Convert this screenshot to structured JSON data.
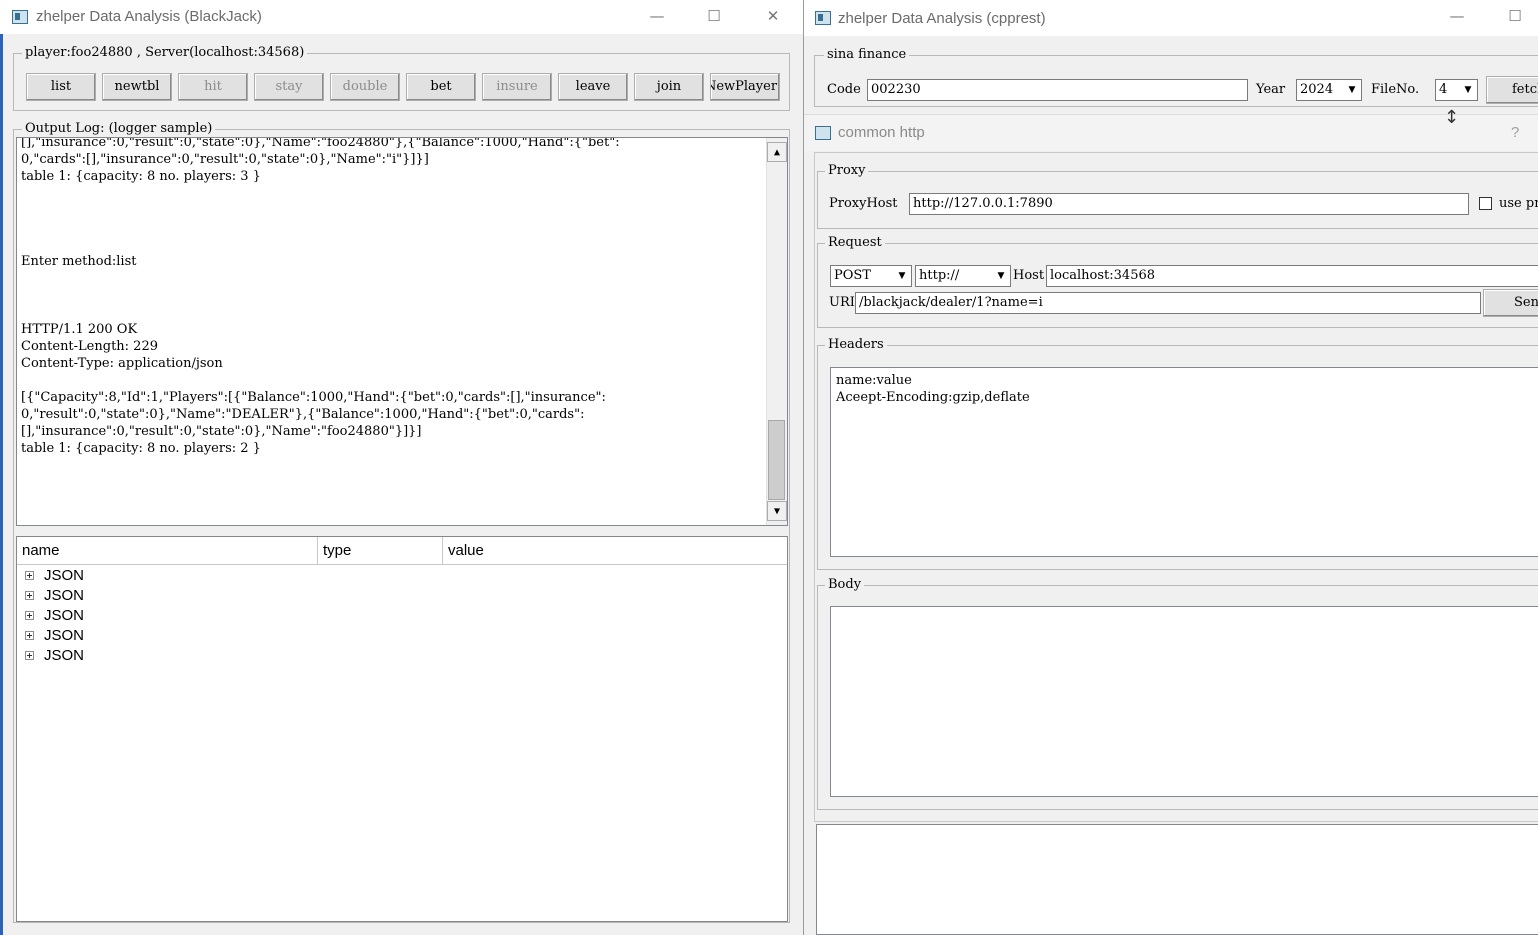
{
  "left_window": {
    "title": "zhelper Data Analysis (BlackJack)",
    "controls": {
      "minimize": "—",
      "maximize": "☐",
      "close": "✕"
    },
    "player_group_label": "player:foo24880 , Server(localhost:34568)",
    "buttons": [
      {
        "label": "list",
        "enabled": true
      },
      {
        "label": "newtbl",
        "enabled": true
      },
      {
        "label": "hit",
        "enabled": false
      },
      {
        "label": "stay",
        "enabled": false
      },
      {
        "label": "double",
        "enabled": false
      },
      {
        "label": "bet",
        "enabled": true
      },
      {
        "label": "insure",
        "enabled": false
      },
      {
        "label": "leave",
        "enabled": true
      },
      {
        "label": "join",
        "enabled": true
      },
      {
        "label": "NewPlayer",
        "enabled": true
      }
    ],
    "log_label": "Output Log: (logger sample)",
    "log_lines": [
      "[],\"insurance\":0,\"result\":0,\"state\":0},\"Name\":\"foo24880\"},{\"Balance\":1000,\"Hand\":{\"bet\":",
      "0,\"cards\":[],\"insurance\":0,\"result\":0,\"state\":0},\"Name\":\"i\"}]}]",
      "table 1: {capacity: 8 no. players: 3 }",
      "",
      "",
      "",
      "",
      "Enter method:list",
      "",
      "",
      "",
      "HTTP/1.1 200 OK",
      "Content-Length: 229",
      "Content-Type: application/json",
      "",
      "[{\"Capacity\":8,\"Id\":1,\"Players\":[{\"Balance\":1000,\"Hand\":{\"bet\":0,\"cards\":[],\"insurance\":",
      "0,\"result\":0,\"state\":0},\"Name\":\"DEALER\"},{\"Balance\":1000,\"Hand\":{\"bet\":0,\"cards\":",
      "[],\"insurance\":0,\"result\":0,\"state\":0},\"Name\":\"foo24880\"}]}]",
      "table 1: {capacity: 8 no. players: 2 }"
    ],
    "tree_columns": [
      "name",
      "type",
      "value"
    ],
    "tree_items": [
      "JSON",
      "JSON",
      "JSON",
      "JSON",
      "JSON"
    ]
  },
  "right_window": {
    "title": "zhelper Data Analysis (cpprest)",
    "controls": {
      "minimize": "—",
      "maximize": "☐"
    },
    "sina_label": "sina finance",
    "code_label": "Code",
    "code_value": "002230",
    "year_label": "Year",
    "year_value": "2024",
    "fileno_label": "FileNo.",
    "fileno_value": "4",
    "fetch_label": "fetch",
    "http_title": "common http",
    "help_icon": "?",
    "proxy_label": "Proxy",
    "proxyhost_label": "ProxyHost",
    "proxyhost_value": "http://127.0.0.1:7890",
    "use_proxy_label": "use proxy",
    "request_label": "Request",
    "method_value": "POST",
    "scheme_value": "http://",
    "host_label": "Host",
    "host_value": "localhost:34568",
    "uri_label": "URI",
    "uri_value": "/blackjack/dealer/1?name=i",
    "send_label": "Send",
    "headers_label": "Headers",
    "headers_lines": [
      "name:value",
      "Aceept-Encoding:gzip,deflate"
    ],
    "body_label": "Body",
    "body_text": ""
  }
}
